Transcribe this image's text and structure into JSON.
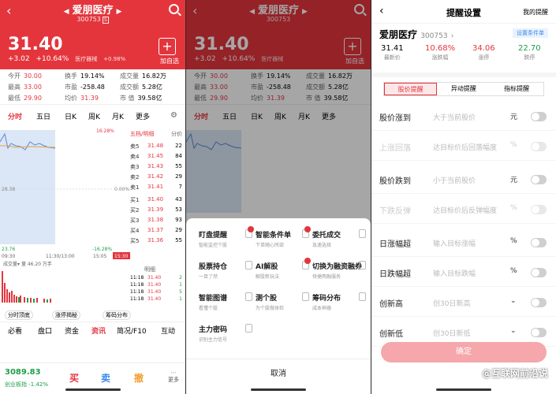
{
  "p1": {
    "title": "爱朋医疗",
    "code": "300753",
    "code_tag": "S",
    "price": "31.40",
    "change": "+3.02",
    "change_pct": "+10.64%",
    "sector": "医疗器械",
    "sector_pct": "+0.98%",
    "add_label": "加自选",
    "stats": {
      "open_k": "今开",
      "open_v": "30.00",
      "turn_k": "换手",
      "turn_v": "19.14%",
      "amt_k": "成交量",
      "amt_v": "16.82万",
      "high_k": "最高",
      "high_v": "33.00",
      "pe_k": "市盈",
      "pe_v": "-258.48",
      "val_k": "成交额",
      "val_v": "5.28亿",
      "low_k": "最低",
      "low_v": "29.90",
      "avg_k": "均价",
      "avg_v": "31.39",
      "mcap_k": "市 值",
      "mcap_v": "39.58亿"
    },
    "tabs": [
      "分时",
      "五日",
      "日K",
      "周K",
      "月K",
      "更多"
    ],
    "chart": {
      "top_pct": "16.28%",
      "mid": "0.00%",
      "bot_pct": "-16.28%",
      "left_mid": "28.38",
      "left_bot": "23.76",
      "t_start": "09:30",
      "t_mid": "11:30/13:00",
      "t_end": "15:05",
      "t_right": "15:30",
      "vol_label": "成交量",
      "vol_val": "量 46.20 万手"
    },
    "book_header": "五档/明细",
    "book_header2": "分价",
    "asks": [
      {
        "l": "卖5",
        "p": "31.48",
        "v": "22"
      },
      {
        "l": "卖4",
        "p": "31.45",
        "v": "84"
      },
      {
        "l": "卖3",
        "p": "31.43",
        "v": "55"
      },
      {
        "l": "卖2",
        "p": "31.42",
        "v": "29"
      },
      {
        "l": "卖1",
        "p": "31.41",
        "v": "7"
      }
    ],
    "bids": [
      {
        "l": "买1",
        "p": "31.40",
        "v": "43"
      },
      {
        "l": "买2",
        "p": "31.39",
        "v": "53"
      },
      {
        "l": "买3",
        "p": "31.38",
        "v": "93"
      },
      {
        "l": "买4",
        "p": "31.37",
        "v": "29"
      },
      {
        "l": "买5",
        "p": "31.36",
        "v": "55"
      }
    ],
    "detail_label": "明细",
    "details": [
      {
        "t": "11:18",
        "p": "31.40",
        "v": "2"
      },
      {
        "t": "11:18",
        "p": "31.40",
        "v": "1"
      },
      {
        "t": "11:18",
        "p": "31.40",
        "v": "5"
      },
      {
        "t": "11:18",
        "p": "31.40",
        "v": "1"
      }
    ],
    "sub_btns": [
      "分时顶底",
      "涨停揭秘",
      "筹码分布"
    ],
    "bottom_tabs": [
      "必看",
      "盘口",
      "资金",
      "资讯",
      "简况/F10",
      "互动"
    ],
    "index_val": "3089.83",
    "index_label": "创业板指",
    "index_pct": "-1.42%",
    "buy": "买",
    "sell": "卖",
    "cancel": "撤",
    "more": "更多"
  },
  "p2": {
    "features": [
      {
        "t": "盯盘提醒",
        "s": "智能监控个股"
      },
      {
        "t": "智能条件单",
        "s": "下单随心所欲"
      },
      {
        "t": "委托成交",
        "s": "急速选择"
      },
      {
        "t": "股票持仓",
        "s": "一目了然"
      },
      {
        "t": "AI解股",
        "s": "解股新玩法"
      },
      {
        "t": "切换为融资融券",
        "s": "快捷两融服务"
      },
      {
        "t": "智能图谱",
        "s": "看懂个股"
      },
      {
        "t": "测个股",
        "s": "为个股做体检"
      },
      {
        "t": "筹码分布",
        "s": "成本神器"
      },
      {
        "t": "主力密码",
        "s": "识别主力信号"
      }
    ],
    "cancel": "取消"
  },
  "p3": {
    "title": "提醒设置",
    "mine": "我的提醒",
    "stock": "爱朋医疗",
    "code": "300753",
    "cond_btn": "设置条件单",
    "kv": [
      {
        "v": "31.41",
        "k": "最新价"
      },
      {
        "v": "10.68%",
        "k": "涨跌幅"
      },
      {
        "v": "34.06",
        "k": "涨停"
      },
      {
        "v": "22.70",
        "k": "跌停"
      }
    ],
    "seg": [
      "股价提醒",
      "异动提醒",
      "指标提醒"
    ],
    "rows": [
      {
        "lbl": "股价涨到",
        "ph": "大于当前股价",
        "unit": "元"
      },
      {
        "lbl": "上涨回落",
        "ph": "达目标价后回落幅度",
        "unit": "%"
      },
      {
        "lbl": "股价跌到",
        "ph": "小于当前股价",
        "unit": "元"
      },
      {
        "lbl": "下跌反弹",
        "ph": "达目标价后反弹幅度",
        "unit": "%"
      },
      {
        "lbl": "日涨幅超",
        "ph": "输入目标涨幅",
        "unit": "%"
      },
      {
        "lbl": "日跌幅超",
        "ph": "输入目标跌幅",
        "unit": "%"
      },
      {
        "lbl": "创新高",
        "ph": "创30日新高",
        "unit": "⌄"
      },
      {
        "lbl": "创新低",
        "ph": "创30日新低",
        "unit": "⌄"
      }
    ],
    "confirm": "确定",
    "watermark": "@互联网前沿说"
  }
}
